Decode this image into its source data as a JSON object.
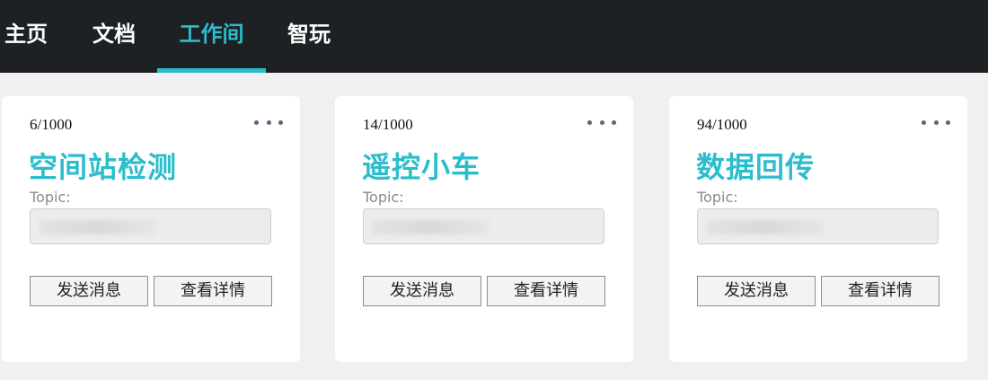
{
  "nav": {
    "items": [
      {
        "label": "主页"
      },
      {
        "label": "文档"
      },
      {
        "label": "工作间",
        "active": true
      },
      {
        "label": "智玩"
      }
    ]
  },
  "colors": {
    "accent": "#2bbdcc",
    "topbar": "#1e2124",
    "background": "#f0f0f0"
  },
  "cards": [
    {
      "count": "6/1000",
      "title": "空间站检测",
      "topic_label": "Topic:",
      "topic_value": "",
      "send_label": "发送消息",
      "detail_label": "查看详情",
      "menu_icon": "more-horizontal-icon"
    },
    {
      "count": "14/1000",
      "title": "遥控小车",
      "topic_label": "Topic:",
      "topic_value": "",
      "send_label": "发送消息",
      "detail_label": "查看详情",
      "menu_icon": "more-horizontal-icon"
    },
    {
      "count": "94/1000",
      "title": "数据回传",
      "topic_label": "Topic:",
      "topic_value": "",
      "send_label": "发送消息",
      "detail_label": "查看详情",
      "menu_icon": "more-horizontal-icon"
    }
  ]
}
